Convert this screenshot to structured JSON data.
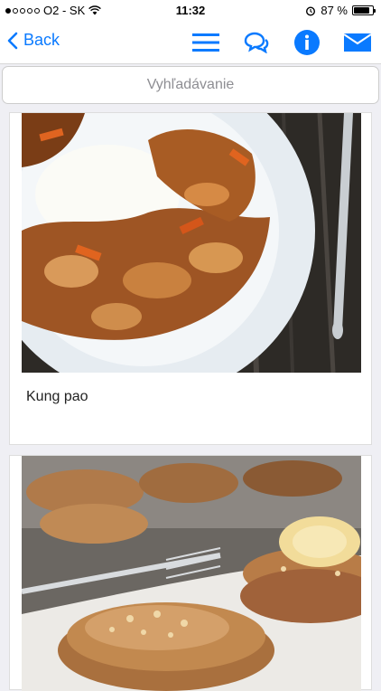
{
  "status_bar": {
    "carrier": "O2 - SK",
    "time": "11:32",
    "battery": "87 %",
    "battery_level": 0.87
  },
  "nav": {
    "back_label": "Back",
    "icons": [
      "menu-icon",
      "chat-icon",
      "info-icon",
      "mail-icon"
    ],
    "accent_color": "#0a7aff"
  },
  "search": {
    "placeholder": "Vyhľadávanie"
  },
  "recipes": [
    {
      "title": "Kung pao",
      "image": "kung-pao-dish-photo"
    },
    {
      "title": "",
      "image": "pancakes-photo"
    }
  ]
}
